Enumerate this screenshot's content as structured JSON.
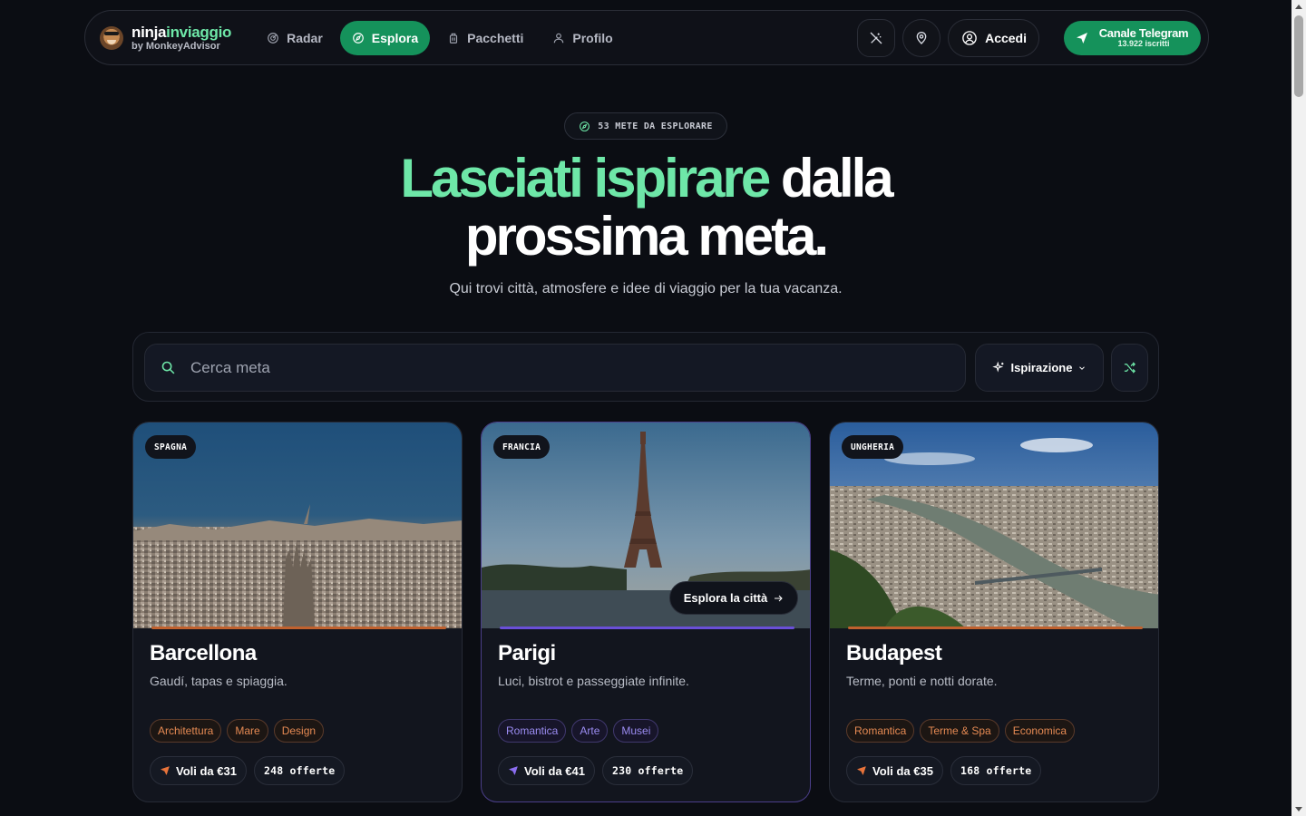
{
  "brand": {
    "name_part1": "ninja",
    "name_part2": "inviaggio",
    "sub": "by MonkeyAdvisor"
  },
  "nav": {
    "items": [
      {
        "label": "Radar",
        "icon": "radar-icon"
      },
      {
        "label": "Esplora",
        "icon": "compass-icon",
        "active": true
      },
      {
        "label": "Pacchetti",
        "icon": "luggage-icon"
      },
      {
        "label": "Profilo",
        "icon": "user-icon"
      }
    ],
    "login_label": "Accedi",
    "telegram": {
      "title": "Canale Telegram",
      "subscribers": "13.922 iscritti"
    }
  },
  "hero": {
    "pill": "53 METE DA ESPLORARE",
    "title_green": "Lasciati ispirare",
    "title_rest_line1": " dalla",
    "title_line2": "prossima meta.",
    "subtitle": "Qui trovi città, atmosfere e idee di viaggio per la tua vacanza."
  },
  "search": {
    "placeholder": "Cerca meta",
    "filter_label": "Ispirazione"
  },
  "colors": {
    "accent_green": "#6ee7a8",
    "button_green": "#15925b",
    "tag_orange": "#e58a53",
    "tag_purple": "#9b8cf2"
  },
  "cards": [
    {
      "country": "SPAGNA",
      "city": "Barcellona",
      "desc": "Gaudí, tapas e spiaggia.",
      "tags": [
        "Architettura",
        "Mare",
        "Design"
      ],
      "tag_color": "orange",
      "flights": "Voli da €31",
      "offers": "248 offerte"
    },
    {
      "country": "FRANCIA",
      "city": "Parigi",
      "desc": "Luci, bistrot e passeggiate infinite.",
      "tags": [
        "Romantica",
        "Arte",
        "Musei"
      ],
      "tag_color": "purple",
      "flights": "Voli da €41",
      "offers": "230 offerte",
      "explore_label": "Esplora la città"
    },
    {
      "country": "UNGHERIA",
      "city": "Budapest",
      "desc": "Terme, ponti e notti dorate.",
      "tags": [
        "Romantica",
        "Terme & Spa",
        "Economica"
      ],
      "tag_color": "orange",
      "flights": "Voli da €35",
      "offers": "168 offerte"
    }
  ]
}
